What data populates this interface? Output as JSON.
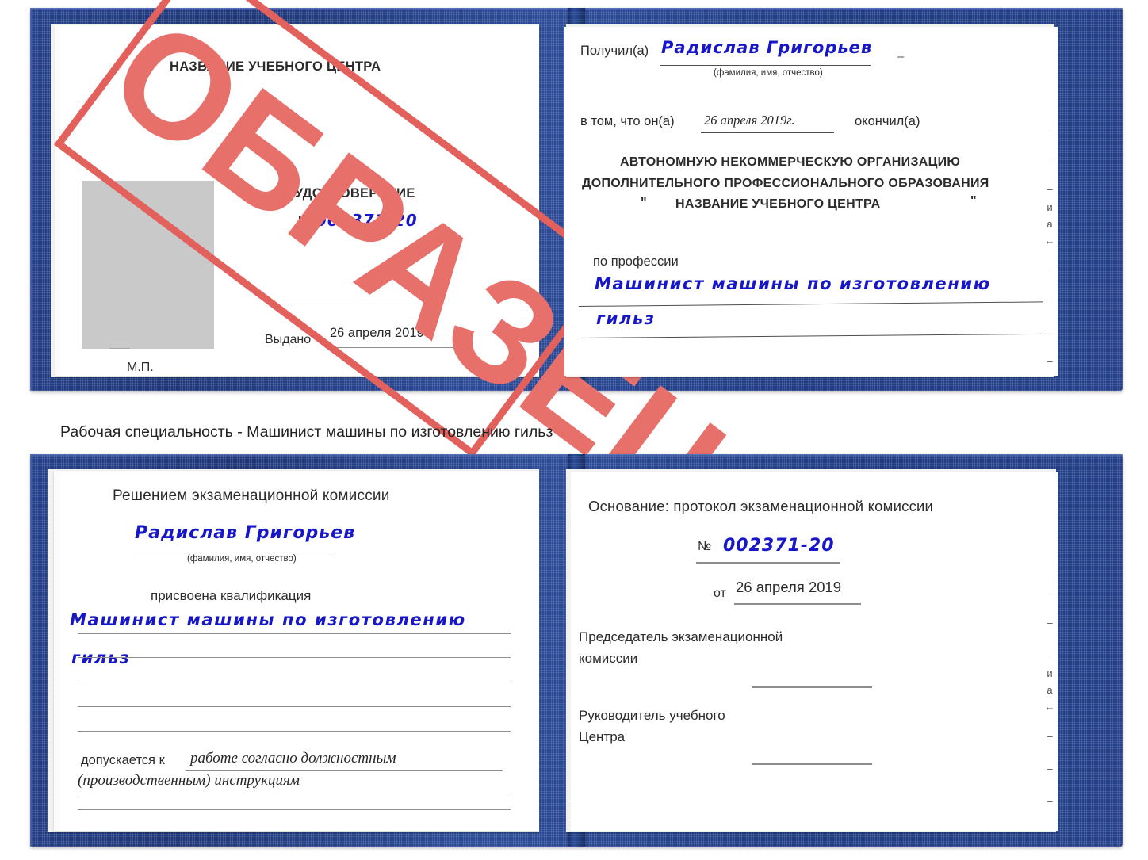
{
  "document": {
    "kind": "Удостоверение (образец)",
    "stamp_text": "ОБРАЗЕЦ",
    "accent_red": "#e8706b",
    "cover_blue": "#24408a",
    "ink_blue": "#1717c9"
  },
  "caption": {
    "text": "Рабочая специальность - Машинист машины по изготовлению гильз"
  },
  "cert_top": {
    "left_page": {
      "center_name": "НАЗВАНИЕ УЧЕБНОГО ЦЕНТРА",
      "title": "УДОСТОВЕРЕНИЕ",
      "number_label": "№",
      "number_value": "002371-20",
      "issued_label": "Выдано",
      "issued_value": "26 апреля 2019",
      "seal_label": "М.П.",
      "photo_placeholder": "photo-box"
    },
    "right_page": {
      "received_label": "Получил(а)",
      "received_value": "Радислав Григорьев",
      "fio_hint": "(фамилия, имя, отчество)",
      "in_that_label": "в том, что он(а)",
      "completed_date": "26 апреля 2019г.",
      "finished_label": "окончил(а)",
      "org_line1": "АВТОНОМНУЮ НЕКОММЕРЧЕСКУЮ ОРГАНИЗАЦИЮ",
      "org_line2": "ДОПОЛНИТЕЛЬНОГО ПРОФЕССИОНАЛЬНОГО ОБРАЗОВАНИЯ",
      "org_quote_open": "\"",
      "org_line3": "НАЗВАНИЕ УЧЕБНОГО ЦЕНТРА",
      "org_quote_close": "\"",
      "profession_label": "по профессии",
      "profession_value_line1": "Машинист машины по изготовлению",
      "profession_value_line2": "гильз",
      "edge_marks": [
        "–",
        "–",
        "–",
        "и",
        "а",
        "←",
        "–",
        "–",
        "–",
        "–"
      ]
    }
  },
  "cert_bottom": {
    "left_page": {
      "heading": "Решением экзаменационной комиссии",
      "name_value": "Радислав Григорьев",
      "fio_hint": "(фамилия, имя, отчество)",
      "qualification_label": "присвоена квалификация",
      "qualification_line1": "Машинист машины по изготовлению",
      "qualification_line2": "гильз",
      "admitted_label": "допускается к",
      "admitted_value_line1": "работе согласно должностным",
      "admitted_value_line2": "(производственным) инструкциям"
    },
    "right_page": {
      "basis_label": "Основание: протокол экзаменационной комиссии",
      "number_label": "№",
      "number_value": "002371-20",
      "from_label": "от",
      "from_value": "26 апреля 2019",
      "chair_line1": "Председатель экзаменационной",
      "chair_line2": "комиссии",
      "head_line1": "Руководитель учебного",
      "head_line2": "Центра",
      "edge_marks": [
        "–",
        "–",
        "–",
        "и",
        "а",
        "←",
        "–",
        "–",
        "–",
        "–"
      ]
    }
  }
}
